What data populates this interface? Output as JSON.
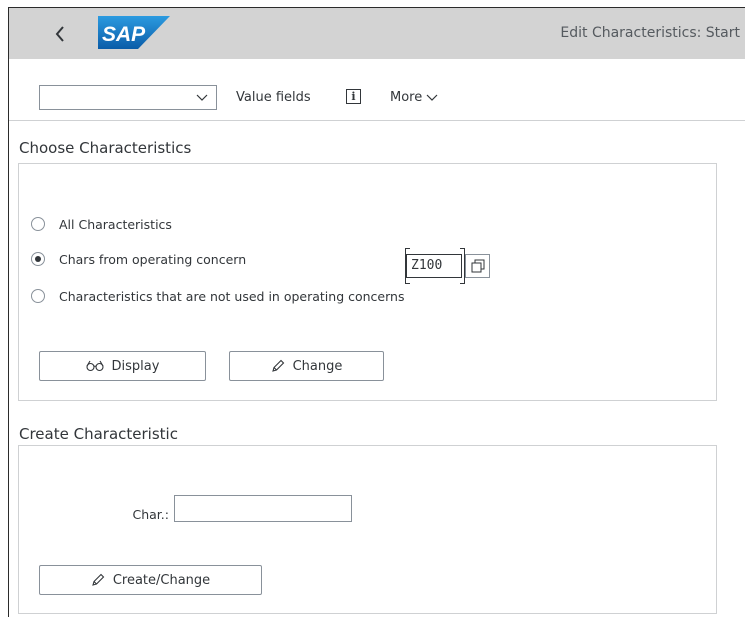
{
  "shell": {
    "back_icon": "chevron-left-icon",
    "logo_text": "SAP",
    "title": "Edit Characteristics: Start"
  },
  "toolbar": {
    "select_value": "",
    "value_fields_label": "Value fields",
    "info_icon": "information-icon",
    "info_glyph": "i",
    "more_label": "More"
  },
  "choose": {
    "title": "Choose Characteristics",
    "options": [
      {
        "label": "All Characteristics",
        "checked": false
      },
      {
        "label": "Chars from operating concern",
        "checked": true
      },
      {
        "label": "Characteristics that are not used in operating concerns",
        "checked": false
      }
    ],
    "operating_concern_value": "Z100",
    "display_button": "Display",
    "change_button": "Change"
  },
  "create": {
    "title": "Create Characteristic",
    "char_label": "Char.:",
    "char_value": "",
    "create_change_button": "Create/Change"
  },
  "colors": {
    "shell_bg": "#d3d3d3",
    "text": "#32363a",
    "border": "#89919a"
  }
}
